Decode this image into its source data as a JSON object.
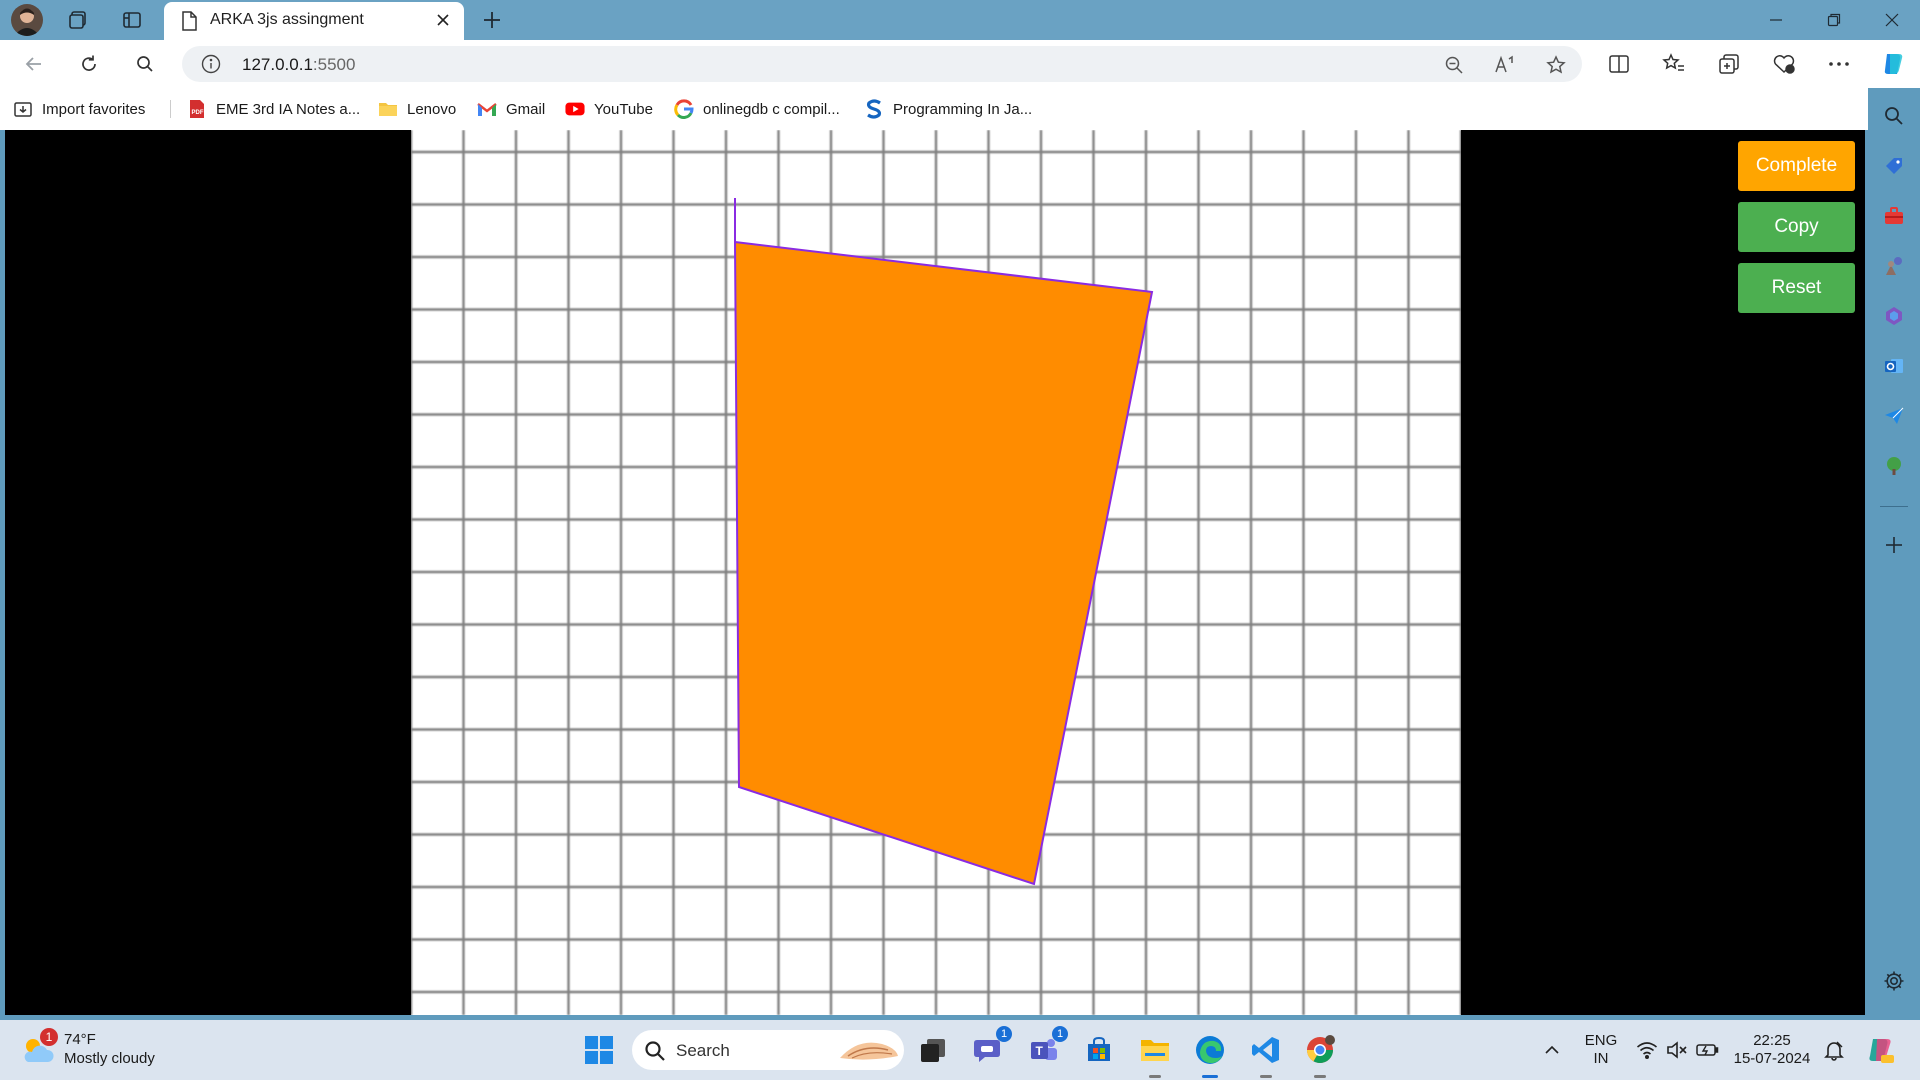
{
  "browser": {
    "tab_title": "ARKA 3js assingment",
    "url_host": "127.0.0.1",
    "url_port": ":5500"
  },
  "favorites": [
    {
      "label": "Import favorites",
      "icon": "import-favorites-icon"
    },
    {
      "label": "EME 3rd IA Notes a...",
      "icon": "pdf-icon"
    },
    {
      "label": "Lenovo",
      "icon": "folder-icon"
    },
    {
      "label": "Gmail",
      "icon": "gmail-icon"
    },
    {
      "label": "YouTube",
      "icon": "youtube-icon"
    },
    {
      "label": "onlinegdb c compil...",
      "icon": "google-icon"
    },
    {
      "label": "Programming In Ja...",
      "icon": "scaler-icon"
    }
  ],
  "controls": {
    "complete_label": "Complete",
    "copy_label": "Copy",
    "reset_label": "Reset"
  },
  "colors": {
    "complete_button": "#ffa500",
    "copy_button": "#4caf50",
    "reset_button": "#4caf50",
    "shape_fill": "#ff8c00",
    "shape_stroke": "#8a2be2",
    "grid_line": "#808080"
  },
  "weather": {
    "temperature": "74°F",
    "condition": "Mostly cloudy",
    "alert_count": "1"
  },
  "taskbar": {
    "search_placeholder": "Search",
    "teams_badge": "1",
    "meet_badge": "1"
  },
  "tray": {
    "language": "ENG",
    "region": "IN",
    "time": "22:25",
    "date": "15-07-2024"
  }
}
